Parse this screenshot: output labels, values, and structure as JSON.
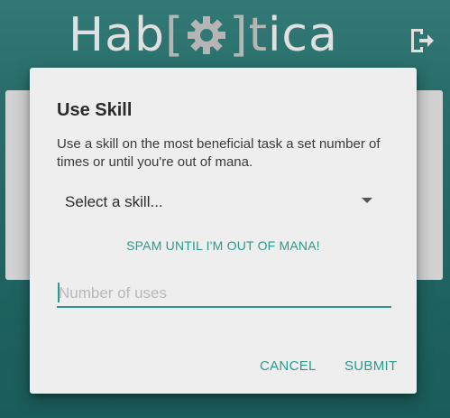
{
  "app": {
    "logo": {
      "part1": "Hab",
      "bracket_left": "[",
      "bracket_right": "]",
      "part2": "t",
      "part3": "ica"
    },
    "logout_icon": "logout-icon",
    "colors": {
      "teal_bg": "#2f7e7a",
      "accent": "#2a9a8c"
    }
  },
  "dialog": {
    "title": "Use Skill",
    "description": "Use a skill on the most beneficial task a set number of times or until you're out of mana.",
    "skill_select": {
      "value": "Select a skill..."
    },
    "spam_label": "SPAM UNTIL I'M OUT OF MANA!",
    "uses_input": {
      "placeholder": "Number of uses",
      "value": ""
    },
    "cancel_label": "CANCEL",
    "submit_label": "SUBMIT"
  }
}
